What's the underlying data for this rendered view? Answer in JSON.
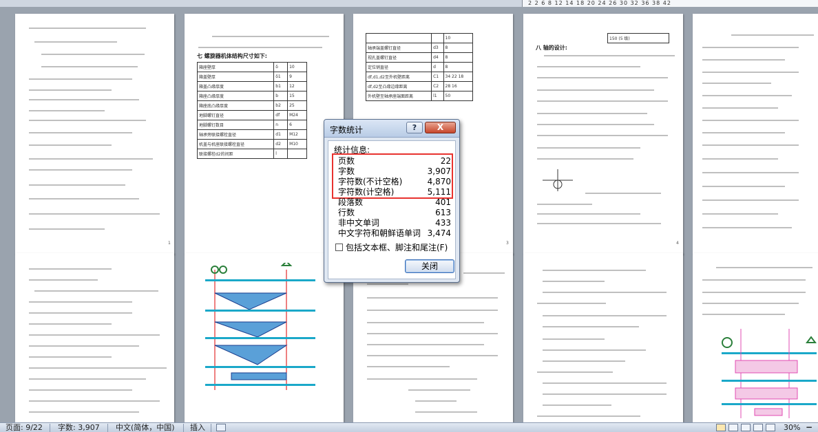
{
  "ruler": {
    "ticks": "2  2  6 8  12 14  18 20  24 26  30 32  36 38  42"
  },
  "dialog": {
    "title": "字数统计",
    "help_label": "?",
    "close_label": "X",
    "stats_header": "统计信息:",
    "stats": [
      {
        "label": "页数",
        "value": "22"
      },
      {
        "label": "字数",
        "value": "3,907"
      },
      {
        "label": "字符数(不计空格)",
        "value": "4,870"
      },
      {
        "label": "字符数(计空格)",
        "value": "5,111"
      },
      {
        "label": "段落数",
        "value": "401"
      },
      {
        "label": "行数",
        "value": "613"
      },
      {
        "label": "非中文单词",
        "value": "433"
      },
      {
        "label": "中文字符和朝鲜语单词",
        "value": "3,474"
      }
    ],
    "checkbox_label": "包括文本框、脚注和尾注(F)",
    "checkbox_checked": false,
    "close_button": "关闭",
    "highlight_color": "#e8322e"
  },
  "pages": {
    "p2_heading": "七  螺旋器机体结构尺寸如下:",
    "p2_table": [
      [
        "箱座壁厚",
        "δ",
        "10"
      ],
      [
        "箱盖壁厚",
        "δ1",
        "9"
      ],
      [
        "箱盖凸缘厚度",
        "b1",
        "12"
      ],
      [
        "箱座凸缘厚度",
        "b",
        "15"
      ],
      [
        "箱座底凸缘厚度",
        "b2",
        "25"
      ],
      [
        "地脚螺钉直径",
        "df",
        "M24"
      ],
      [
        "地脚螺钉数目",
        "n",
        "6"
      ],
      [
        "轴承旁联接螺栓直径",
        "d1",
        "M12"
      ],
      [
        "机盖与机座联接螺栓直径",
        "d2",
        "M10"
      ],
      [
        "联接螺栓d2的间距",
        "l",
        ""
      ]
    ],
    "p3_table": [
      [
        "",
        "",
        "10"
      ],
      [
        "轴承端盖螺钉直径",
        "d3",
        "8"
      ],
      [
        "视孔盖螺钉直径",
        "d4",
        "8"
      ],
      [
        "定位销直径",
        "d",
        "8"
      ],
      [
        "df,d1,d2至外机壁距离",
        "C1",
        "34 22 18"
      ],
      [
        "df,d2至凸缘边缘距离",
        "C2",
        "28 16"
      ],
      [
        "外机壁至轴承座端面距离",
        "l1",
        "50"
      ]
    ],
    "p4_cell": "150 (5 级)",
    "p4_heading": "八  轴的设计:"
  },
  "statusbar": {
    "page": "页面: 9/22",
    "words": "字数: 3,907",
    "language": "中文(简体，中国)",
    "mode": "插入",
    "zoom": "30%",
    "zoom_minus": "−"
  }
}
